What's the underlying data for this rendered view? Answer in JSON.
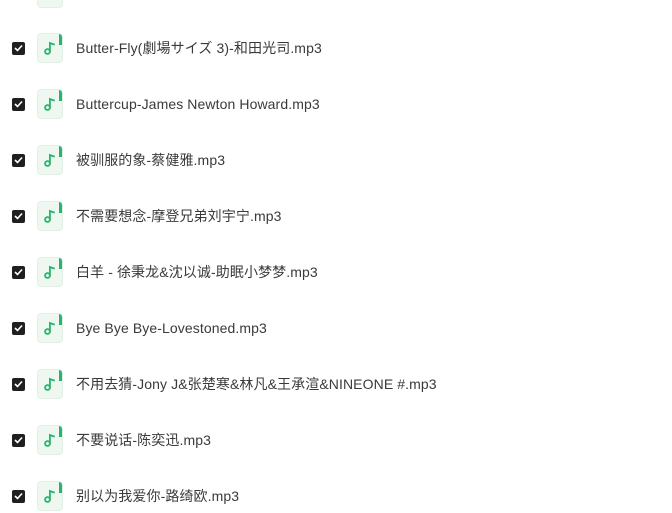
{
  "files": [
    {
      "name": "Butter-Fly(劇場サイズ 3)-和田光司.mp3",
      "checked": true,
      "icon": "music-note-icon"
    },
    {
      "name": "Buttercup-James Newton Howard.mp3",
      "checked": true,
      "icon": "music-note-icon"
    },
    {
      "name": "被驯服的象-蔡健雅.mp3",
      "checked": true,
      "icon": "music-note-icon"
    },
    {
      "name": "不需要想念-摩登兄弟刘宇宁.mp3",
      "checked": true,
      "icon": "music-note-icon"
    },
    {
      "name": "白羊 - 徐秉龙&沈以诚-助眠小梦梦.mp3",
      "checked": true,
      "icon": "music-note-icon"
    },
    {
      "name": "Bye Bye Bye-Lovestoned.mp3",
      "checked": true,
      "icon": "music-note-icon"
    },
    {
      "name": "不用去猜-Jony J&张楚寒&林凡&王承渲&NINEONE #.mp3",
      "checked": true,
      "icon": "music-note-icon"
    },
    {
      "name": "不要说话-陈奕迅.mp3",
      "checked": true,
      "icon": "music-note-icon"
    },
    {
      "name": "别以为我爱你-路绮欧.mp3",
      "checked": true,
      "icon": "music-note-icon"
    }
  ],
  "colors": {
    "accent": "#26b36b",
    "checkbox": "#1f1f1f",
    "text": "#3a3a3a",
    "icon_bg": "#eef8f1"
  }
}
